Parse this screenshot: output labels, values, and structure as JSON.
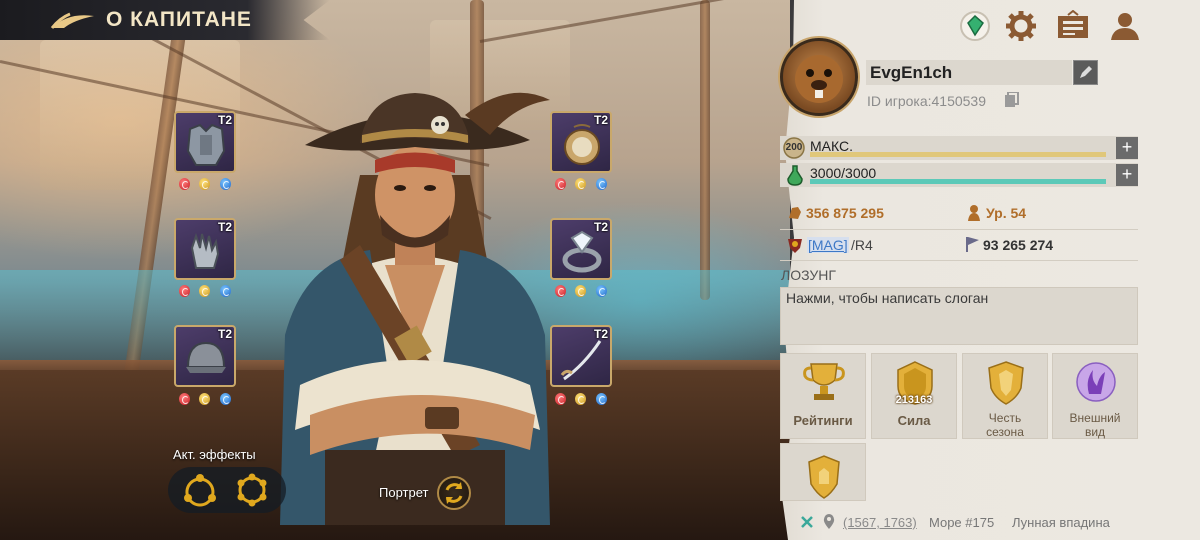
{
  "header": {
    "title": "О КАПИТАНЕ"
  },
  "equipment": {
    "left": [
      {
        "name": "armor",
        "tier": "T2"
      },
      {
        "name": "gloves",
        "tier": "T2"
      },
      {
        "name": "helmet",
        "tier": "T2"
      }
    ],
    "right": [
      {
        "name": "amulet",
        "tier": "T2"
      },
      {
        "name": "ring",
        "tier": "T2"
      },
      {
        "name": "sabre",
        "tier": "T2"
      }
    ],
    "gem_colors": [
      "#d9232b",
      "#e0a81e",
      "#2a7bd9"
    ]
  },
  "effects": {
    "label": "Акт. эффекты"
  },
  "portrait": {
    "label": "Портрет"
  },
  "player": {
    "name": "EvgEn1ch",
    "id_text": "ID игрока:4150539"
  },
  "bars": {
    "level": {
      "badge": "200",
      "label": "МАКС.",
      "fill_fraction": 1.0,
      "color": "#e0c77a"
    },
    "stamina": {
      "label": "3000/3000",
      "fill_fraction": 1.0,
      "color": "#5cc9b8"
    }
  },
  "stats": {
    "power_gold": "356 875 295",
    "level": "Ур. 54",
    "alliance_tag": "[MAG]",
    "alliance_rank": "/R4",
    "kills": "93 265 274"
  },
  "slogan": {
    "title": "ЛОЗУНГ",
    "placeholder": "Нажми, чтобы написать слоган"
  },
  "tiles": [
    {
      "label": "Рейтинги"
    },
    {
      "label": "Сила",
      "value": "213163"
    },
    {
      "label_line1": "Честь",
      "label_line2": "сезона"
    },
    {
      "label_line1": "Внешний",
      "label_line2": "вид"
    }
  ],
  "location": {
    "coords": "(1567, 1763)",
    "sea": "Море #175",
    "region": "Лунная впадина"
  },
  "colors": {
    "accent_gold": "#b06e2a",
    "panel_bg": "#ece8e1",
    "slot_border": "#c9a86a"
  }
}
